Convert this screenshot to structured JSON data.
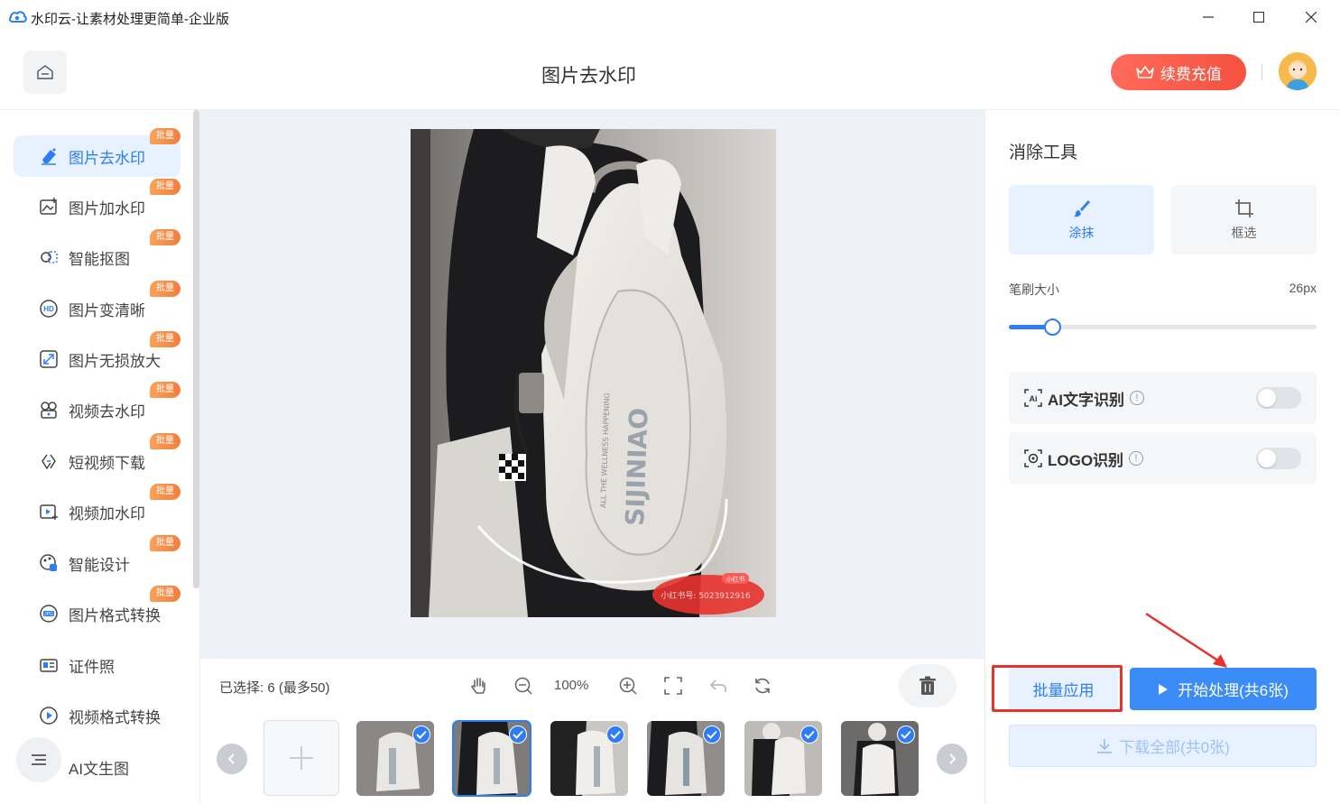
{
  "window": {
    "title": "水印云-让素材处理更简单-企业版"
  },
  "header": {
    "page_title": "图片去水印",
    "renew_label": "续费充值"
  },
  "sidebar": {
    "items": [
      {
        "label": "图片去水印",
        "badge": "批量",
        "icon": "eraser-icon",
        "active": true
      },
      {
        "label": "图片加水印",
        "badge": "批量",
        "icon": "image-add-icon"
      },
      {
        "label": "智能抠图",
        "badge": "批量",
        "icon": "cutout-icon"
      },
      {
        "label": "图片变清晰",
        "badge": "批量",
        "icon": "hd-icon"
      },
      {
        "label": "图片无损放大",
        "badge": "批量",
        "icon": "enlarge-icon"
      },
      {
        "label": "视频去水印",
        "badge": "批量",
        "icon": "video-eraser-icon"
      },
      {
        "label": "短视频下载",
        "badge": "批量",
        "icon": "link-icon"
      },
      {
        "label": "视频加水印",
        "badge": "批量",
        "icon": "video-add-icon"
      },
      {
        "label": "智能设计",
        "badge": "批量",
        "icon": "design-icon"
      },
      {
        "label": "图片格式转换",
        "badge": "批量",
        "icon": "jpg-icon"
      },
      {
        "label": "证件照",
        "badge": "",
        "icon": "id-card-icon"
      },
      {
        "label": "视频格式转换",
        "badge": "",
        "icon": "play-circle-icon"
      },
      {
        "label": "AI文生图",
        "badge": "",
        "icon": "ai-image-icon"
      }
    ]
  },
  "canvas": {
    "watermark_text": "小红书号: 5023912916",
    "watermark_logo": "小红书"
  },
  "bottom": {
    "selected_text": "已选择:  6 (最多50)",
    "zoom": "100%",
    "thumbnails": [
      {
        "checked": true,
        "selected": false
      },
      {
        "checked": true,
        "selected": true
      },
      {
        "checked": true,
        "selected": false
      },
      {
        "checked": true,
        "selected": false
      },
      {
        "checked": true,
        "selected": false
      },
      {
        "checked": true,
        "selected": false
      }
    ]
  },
  "right_panel": {
    "title": "消除工具",
    "tools": [
      {
        "label": "涂抹",
        "icon": "brush-icon",
        "active": true
      },
      {
        "label": "框选",
        "icon": "crop-icon",
        "active": false
      }
    ],
    "brush_size_label": "笔刷大小",
    "brush_size_value": "26px",
    "brush_size_fraction": 0.14,
    "options": [
      {
        "label": "AI文字识别",
        "icon": "ai-text-icon",
        "enabled": false
      },
      {
        "label": "LOGO识别",
        "icon": "logo-scan-icon",
        "enabled": false
      }
    ],
    "batch_label": "批量应用",
    "start_label": "开始处理(共6张)",
    "download_label": "下载全部(共0张)"
  },
  "colors": {
    "accent": "#2e7cf6",
    "renew": "#f5513f",
    "badge": "#f27d3d",
    "annotation": "#e8322e"
  }
}
